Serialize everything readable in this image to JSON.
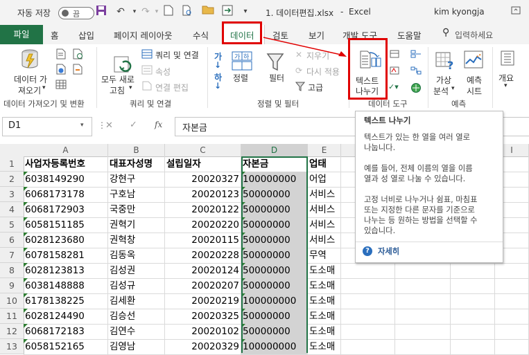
{
  "titlebar": {
    "autosave_label": "자동 저장",
    "autosave_toggle": "끔",
    "filename": "1. 데이터편집.xlsx",
    "separator": "-",
    "app": "Excel",
    "user": "kim kyongja"
  },
  "tabs": {
    "file": "파일",
    "home": "홈",
    "insert": "삽입",
    "page_layout": "페이지 레이아웃",
    "formulas": "수식",
    "data": "데이터",
    "review": "검토",
    "view": "보기",
    "developer": "개발 도구",
    "help": "도움말",
    "search_placeholder": "입력하세요"
  },
  "ribbon": {
    "get_data": {
      "line1": "데이터 가",
      "line2": "져오기"
    },
    "refresh_all": {
      "line1": "모두 새로",
      "line2": "고침"
    },
    "queries": "쿼리 및 연결",
    "properties": "속성",
    "edit_links": "연결 편집",
    "sort": "정렬",
    "filter": "필터",
    "clear": "지우기",
    "reapply": "다시 적용",
    "advanced": "고급",
    "text_to_columns": {
      "line1": "텍스트",
      "line2": "나누기"
    },
    "whatif": {
      "line1": "가상",
      "line2": "분석"
    },
    "forecast_sheet": {
      "line1": "예측",
      "line2": "시트"
    },
    "outline": "개요",
    "groups": {
      "get_transform": "데이터 가져오기 및 변환",
      "queries_connections": "쿼리 및 연결",
      "sort_filter": "정렬 및 필터",
      "data_tools": "데이터 도구",
      "forecast": "예측"
    }
  },
  "formula_bar": {
    "name_box": "D1",
    "fx": "fx",
    "content": "자본금"
  },
  "tooltip": {
    "title": "텍스트 나누기",
    "desc_lines": [
      "텍스트가 있는 한 열을 여러 열로",
      "나눕니다."
    ],
    "example_lines": [
      "예를 들어, 전체 이름의 열을 이름",
      "열과 성 열로 나눌 수 있습니다."
    ],
    "detail_lines": [
      "고정 너비로 나누거나 쉼표, 마침표",
      "또는 지정한 다른 문자를 기준으로",
      "나누는 등 원하는 방법을 선택할 수",
      "있습니다."
    ],
    "more": "자세히"
  },
  "sheet": {
    "columns": [
      "A",
      "B",
      "C",
      "D",
      "E"
    ],
    "extra_columns": [
      "I"
    ],
    "row_numbers": [
      "1",
      "2",
      "3",
      "4",
      "5",
      "6",
      "7",
      "8",
      "9",
      "10",
      "11",
      "12",
      "13"
    ],
    "headers": [
      "사업자등록번호",
      "대표자성명",
      "설립일자",
      "자본금",
      "업태"
    ],
    "rows": [
      [
        "6038149290",
        "강현구",
        "20020327",
        "100000000",
        "어업"
      ],
      [
        "6068173178",
        "구호남",
        "20020123",
        "50000000",
        "서비스"
      ],
      [
        "6068172903",
        "국중만",
        "20020122",
        "50000000",
        "서비스"
      ],
      [
        "6058151185",
        "권혁기",
        "20020220",
        "50000000",
        "서비스"
      ],
      [
        "6028123680",
        "권혁창",
        "20020115",
        "50000000",
        "서비스"
      ],
      [
        "6078158281",
        "김동옥",
        "20020228",
        "50000000",
        "무역"
      ],
      [
        "6028123813",
        "김성권",
        "20020124",
        "50000000",
        "도소매"
      ],
      [
        "6038148888",
        "김성규",
        "20020207",
        "50000000",
        "도소매"
      ],
      [
        "6178138225",
        "김세환",
        "20020219",
        "100000000",
        "도소매"
      ],
      [
        "6028124490",
        "김승선",
        "20020325",
        "50000000",
        "도소매"
      ],
      [
        "6068172183",
        "김연수",
        "20020102",
        "50000000",
        "도소매"
      ],
      [
        "6058152165",
        "김영남",
        "20020329",
        "100000000",
        "도소매"
      ]
    ]
  },
  "colors": {
    "excel_green": "#217346",
    "highlight_red": "#e00000",
    "selected_column": "#d3d3d3"
  }
}
